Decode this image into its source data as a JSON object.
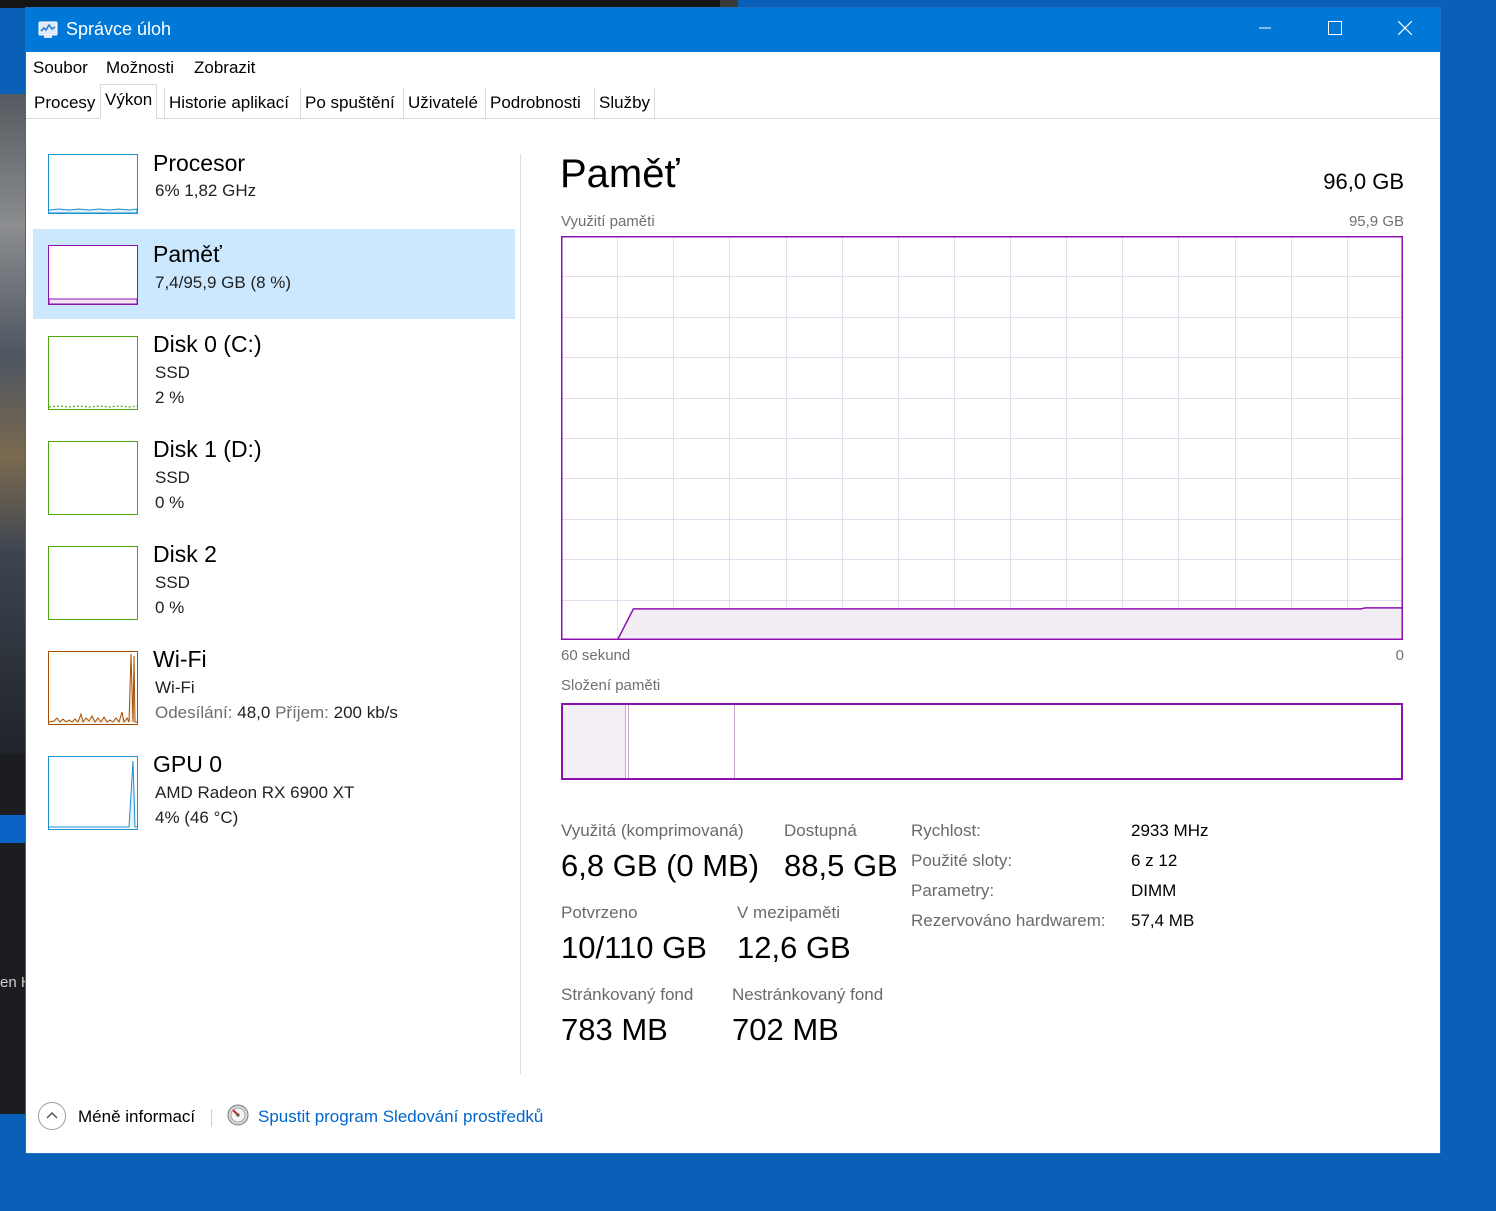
{
  "window": {
    "title": "Správce úloh"
  },
  "menu": [
    "Soubor",
    "Možnosti",
    "Zobrazit"
  ],
  "tabs": [
    "Procesy",
    "Výkon",
    "Historie aplikací",
    "Po spuštění",
    "Uživatelé",
    "Podrobnosti",
    "Služby"
  ],
  "active_tab": "Výkon",
  "sidebar": [
    {
      "name": "Procesor",
      "line1": "6%  1,82 GHz",
      "line2": "",
      "color": "#1b8fd1"
    },
    {
      "name": "Paměť",
      "line1": "7,4/95,9 GB (8 %)",
      "line2": "",
      "color": "#8b12ae"
    },
    {
      "name": "Disk 0 (C:)",
      "line1": "SSD",
      "line2": "2 %",
      "color": "#4da60c"
    },
    {
      "name": "Disk 1 (D:)",
      "line1": "SSD",
      "line2": "0 %",
      "color": "#4da60c"
    },
    {
      "name": "Disk 2",
      "line1": "SSD",
      "line2": "0 %",
      "color": "#4da60c"
    },
    {
      "name": "Wi-Fi",
      "line1": "Wi-Fi",
      "send_label": "Odesílání:",
      "send_value": "48,0",
      "recv_label": "Příjem:",
      "recv_value": "200 kb/s",
      "color": "#a74f01"
    },
    {
      "name": "GPU 0",
      "line1": "AMD Radeon RX 6900 XT",
      "line2": "4%  (46 °C)",
      "color": "#1b8fd1"
    }
  ],
  "memory": {
    "heading": "Paměť",
    "total": "96,0 GB",
    "usage_label": "Využití paměti",
    "usage_max": "95,9 GB",
    "axis_left": "60 sekund",
    "axis_right": "0",
    "composition_label": "Složení paměti",
    "accent": "#8b12ae",
    "usage_fraction": 0.077,
    "stats": {
      "in_use_label": "Využitá (komprimovaná)",
      "in_use_value": "6,8 GB (0 MB)",
      "available_label": "Dostupná",
      "available_value": "88,5 GB",
      "committed_label": "Potvrzeno",
      "committed_value": "10/110 GB",
      "cached_label": "V mezipaměti",
      "cached_value": "12,6 GB",
      "paged_label": "Stránkovaný fond",
      "paged_value": "783 MB",
      "nonpaged_label": "Nestránkovaný fond",
      "nonpaged_value": "702 MB"
    },
    "properties": [
      {
        "label": "Rychlost:",
        "value": "2933 MHz"
      },
      {
        "label": "Použité sloty:",
        "value": "6 z 12"
      },
      {
        "label": "Parametry:",
        "value": "DIMM"
      },
      {
        "label": "Rezervováno hardwarem:",
        "value": "57,4 MB"
      }
    ]
  },
  "footer": {
    "less_info": "Méně informací",
    "resource_monitor": "Spustit program Sledování prostředků"
  },
  "background": {
    "fragment_text": "en H"
  }
}
